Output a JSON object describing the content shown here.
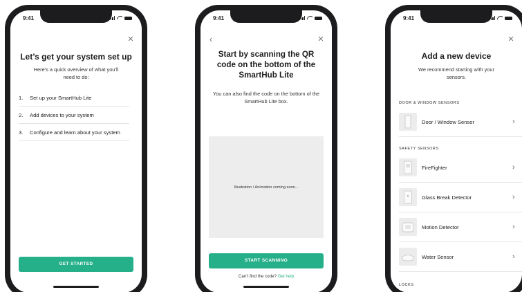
{
  "status": {
    "time": "9:41"
  },
  "screen1": {
    "close_icon": "close-icon",
    "title": "Let’s get your system set up",
    "subtitle": "Here’s a quick overview of what you’ll need to do:",
    "steps": [
      {
        "num": "1.",
        "label": "Set up your SmartHub Lite"
      },
      {
        "num": "2.",
        "label": "Add devices to your system"
      },
      {
        "num": "3.",
        "label": "Configure and learn about your system"
      }
    ],
    "primary_label": "GET STARTED"
  },
  "screen2": {
    "back_icon": "chevron-left-icon",
    "close_icon": "close-icon",
    "title": "Start by scanning the QR code on the bottom of the SmartHub Lite",
    "subtitle": "You can also find the code on the bottom of the SmartHub Lite box.",
    "illustration_placeholder": "Illustration / Animation coming soon...",
    "primary_label": "START SCANNING",
    "help_text": "Can’t find the code?",
    "help_link": "Get help"
  },
  "screen3": {
    "close_icon": "close-icon",
    "title": "Add a new device",
    "subtitle": "We recommend starting with your sensors.",
    "sections": [
      {
        "header": "DOOR & WINDOW SENSORS",
        "devices": [
          {
            "name": "Door / Window Sensor"
          }
        ]
      },
      {
        "header": "SAFETY SENSORS",
        "devices": [
          {
            "name": "FireFighter"
          },
          {
            "name": "Glass Break Detector"
          },
          {
            "name": "Motion Detector"
          },
          {
            "name": "Water Sensor"
          }
        ]
      },
      {
        "header": "LOCKS",
        "devices": []
      }
    ]
  },
  "colors": {
    "accent": "#25b089",
    "frame": "#1c1c1e",
    "placeholder_bg": "#ededed"
  }
}
